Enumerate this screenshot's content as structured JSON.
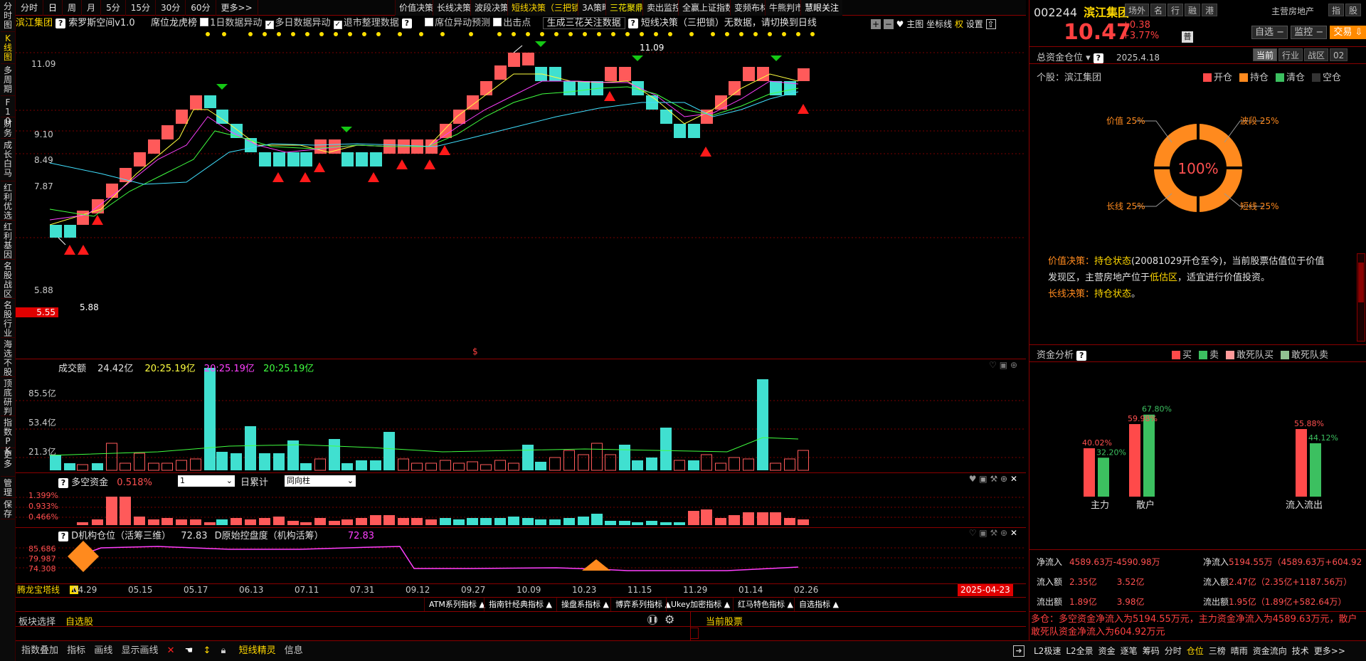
{
  "left_tabs": [
    "分时图",
    "K线图",
    "多周期",
    "F10",
    "财务",
    "成长白马",
    "红利优选",
    "红利基因",
    "名股战区",
    "名股行业",
    "海选不股",
    "顶底研判",
    "指数PK",
    "更多",
    "管理",
    "保存"
  ],
  "period_tabs": [
    "分时",
    "日",
    "周",
    "月",
    "5分",
    "15分",
    "30分",
    "60分",
    "更多>>"
  ],
  "strategy_buttons": [
    "价值决策",
    "长线决策",
    "波段决策",
    "短线决策（三把锁）",
    "3A策略",
    "三花聚鼎",
    "卖出监控",
    "全赢上证指数",
    "变频布林",
    "牛熊判市",
    "慧眼关注"
  ],
  "toolbar2": {
    "stock": "滨江集团",
    "indicator": "索罗斯空间v1.0",
    "rank": "席位龙虎榜",
    "cb1": "1日数据异动",
    "cb2": "多日数据异动",
    "cb3": "退市整理数据",
    "cb4": "席位异动预测",
    "cb5": "出击点",
    "gen": "生成三花关注数据",
    "short": "短线决策（三把锁）无数据，请切换到日线",
    "main": "主图",
    "axis": "坐标线",
    "quan": "权",
    "settings": "设置"
  },
  "kline": {
    "y_ticks": [
      "11.09",
      "9.10",
      "8.49",
      "7.87",
      "5.88"
    ],
    "current_price": "5.55",
    "high_label": "11.09",
    "low_label": "5.88",
    "dollar_mark": "$"
  },
  "volume": {
    "title": "成交额",
    "v1": "24.42亿",
    "v2": "20:25.19亿",
    "v3": "20:25.19亿",
    "v4": "20:25.19亿",
    "y_ticks": [
      "85.5亿",
      "53.4亿",
      "21.3亿"
    ]
  },
  "duokong": {
    "title": "多空资金",
    "value": "0.518%",
    "sel1": "1",
    "mode": "日累计",
    "sel2": "同向柱",
    "y_ticks": [
      "1.399%",
      "0.933%",
      "0.466%"
    ]
  },
  "dinst": {
    "title": "D机构仓位（活筹三维）",
    "value": "72.83",
    "title2": "D原始控盘度（机构活筹）",
    "value2": "72.83",
    "y_ticks": [
      "85.686",
      "79.987",
      "74.308"
    ]
  },
  "timeline": {
    "left_label": "腾龙宝塔线",
    "dates": [
      "04.29",
      "05.15",
      "05.17",
      "06.13",
      "07.11",
      "07.31",
      "09.12",
      "09.27",
      "10.09",
      "10.23",
      "11.15",
      "11.29",
      "01.14",
      "02.26"
    ],
    "cursor_date": "2025-04-23"
  },
  "formula_tabs": [
    "ATM系列指标",
    "指南针经典指标",
    "操盘系指标",
    "博弈系列指标",
    "Ukey加密指标",
    "红马特色指标",
    "自选指标"
  ],
  "bottom_panel": {
    "select": "板块选择",
    "zixuan": "自选股",
    "current": "当前股票"
  },
  "bottom_bar": [
    "指数叠加",
    "指标",
    "画线",
    "显示画线",
    "短线精灵",
    "信息"
  ],
  "right": {
    "code": "002244",
    "name": "滨江集团",
    "tags": [
      "场外",
      "名",
      "行",
      "融",
      "港"
    ],
    "industry": "主营房地产",
    "rt_tabs": [
      "指",
      "股"
    ],
    "price": "10.47",
    "change": "+0.38",
    "change_pct": "+3.77%",
    "pu": "普",
    "zixuan": "自选",
    "jiankong": "监控",
    "trade": "交易",
    "fund_label": "总资金仓位",
    "date": "2025.4.18",
    "period_tabs": [
      "当前",
      "行业",
      "战区",
      "02"
    ],
    "geigu": "个股：滨江集团",
    "legend": [
      "开仓",
      "持仓",
      "清仓",
      "空仓"
    ],
    "donut_center": "100%",
    "donut_labels": [
      "价值 25%",
      "波段 25%",
      "长线 25%",
      "短线 25%"
    ],
    "decision1_key": "价值决策：",
    "decision1_state": "持仓状态",
    "decision1_text": "(20081029开仓至今)，当前股票估值位于价值发现区，主营房地产位于",
    "decision1_low": "低估区",
    "decision1_tail": "，适宜进行价值投资。",
    "decision2_key": "长线决策：",
    "decision2_state": "持仓状态",
    "decision2_tail": "。",
    "analysis_title": "资金分析",
    "analysis_legend": [
      "买",
      "卖",
      "敢死队买",
      "敢死队卖"
    ],
    "bars_left_labels": [
      "主力",
      "散户"
    ],
    "bars_right_label": "流入流出",
    "bar_values": {
      "zl_buy": "40.02%",
      "zl_sell": "32.20%",
      "sh_buy": "59.98%",
      "sh_sell": "67.80%",
      "in": "55.88%",
      "out": "44.12%"
    },
    "stats_left": [
      [
        "净流入",
        "4589.63万-4590.98万"
      ],
      [
        "流入额",
        "2.35亿",
        "3.52亿"
      ],
      [
        "流出额",
        "1.89亿",
        "3.98亿"
      ]
    ],
    "stats_right": [
      [
        "净流入",
        "5194.55万（4589.63万+604.92"
      ],
      [
        "流入额",
        "2.47亿（2.35亿+1187.56万）"
      ],
      [
        "流出额",
        "1.95亿（1.89亿+582.64万）"
      ]
    ],
    "summary": "多仓：多空资金净流入为5194.55万元，主力资金净流入为4589.63万元，散户敢死队资金净流入为604.92万元",
    "bottom_tabs": [
      "L2极速",
      "L2全景",
      "资金",
      "逐笔",
      "筹码",
      "分时",
      "仓位",
      "三榜",
      "晴雨",
      "资金流向",
      "技术",
      "更多>>"
    ]
  },
  "colors": {
    "up": "#ff5a5a",
    "down": "#40e0d0",
    "bg": "#000000",
    "grid": "#8a0000"
  }
}
